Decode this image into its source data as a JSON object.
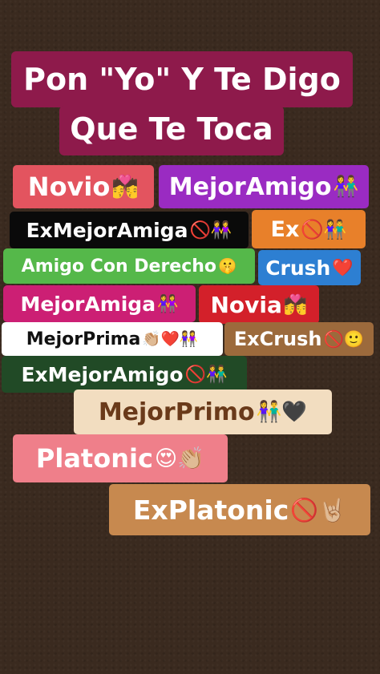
{
  "title": {
    "line1": "Pon \"Yo\" Y Te Digo",
    "line2": "Que Te Toca"
  },
  "tags": [
    {
      "id": "novio",
      "text": "Novio",
      "emoji": "💏"
    },
    {
      "id": "mejor-amigo",
      "text": "MejorAmigo",
      "emoji": "👫"
    },
    {
      "id": "ex-mejor-amiga",
      "text": "ExMejorAmiga",
      "emoji": "🚫👭"
    },
    {
      "id": "ex",
      "text": "Ex",
      "emoji": "🚫👫"
    },
    {
      "id": "amigo-con-derecho",
      "text": "Amigo Con Derecho",
      "emoji": "🤫"
    },
    {
      "id": "crush",
      "text": "Crush",
      "emoji": "❤️"
    },
    {
      "id": "mejor-amiga",
      "text": "MejorAmiga",
      "emoji": "👭"
    },
    {
      "id": "novia",
      "text": "Novia",
      "emoji": "💏"
    },
    {
      "id": "mejor-prima",
      "text": "MejorPrima",
      "emoji": "👏🏼❤️👭"
    },
    {
      "id": "ex-crush",
      "text": "ExCrush",
      "emoji": "🚫🙂"
    },
    {
      "id": "ex-mejor-amigo",
      "text": "ExMejorAmigo",
      "emoji": "🚫👫"
    },
    {
      "id": "mejor-primo",
      "text": "MejorPrimo",
      "emoji": "👫🖤"
    },
    {
      "id": "platonic",
      "text": "Platonic",
      "emoji": "😍👏🏼"
    },
    {
      "id": "ex-platonic",
      "text": "ExPlatonic",
      "emoji": "🚫🤘🏼"
    }
  ],
  "colors": {
    "title_bg": "#8e1a4b",
    "novio": "#e3545f",
    "mejor_amigo": "#9a2bc2",
    "ex_mejor_amiga": "#0a0a0a",
    "ex": "#e8802a",
    "amigo_con_derecho": "#55b84a",
    "crush": "#2d7fd2",
    "mejor_amiga": "#cc1f74",
    "novia": "#d3202a",
    "mejor_prima": "#ffffff",
    "ex_crush": "#9c6a3c",
    "ex_mejor_amigo": "#214a26",
    "mejor_primo": "#f2ddc0",
    "platonic": "#ef7f8a",
    "ex_platonic": "#c7894f"
  }
}
